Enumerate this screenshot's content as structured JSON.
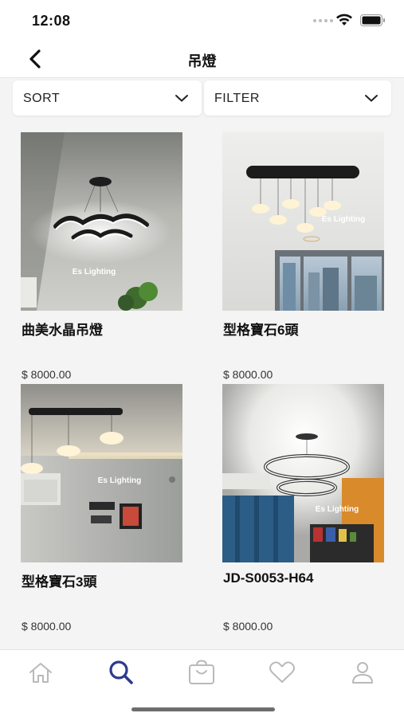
{
  "status_bar": {
    "time": "12:08"
  },
  "nav": {
    "title": "吊燈",
    "back_icon": "chevron-left-icon"
  },
  "toolbar": {
    "sort_label": "SORT",
    "filter_label": "FILTER"
  },
  "products": [
    {
      "name": "曲美水晶吊燈",
      "price": "$ 8000.00",
      "watermark": "Es Lighting"
    },
    {
      "name": "型格寶石6頭",
      "price": "$ 8000.00",
      "watermark": "Es Lighting"
    },
    {
      "name": "型格寶石3頭",
      "price": "$ 8000.00",
      "watermark": "Es Lighting"
    },
    {
      "name": "JD-S0053-H64",
      "price": "$ 8000.00",
      "watermark": "Es Lighting"
    }
  ],
  "tab_bar": {
    "active_tab": "search",
    "tabs": [
      {
        "id": "home",
        "icon": "home-icon"
      },
      {
        "id": "search",
        "icon": "search-icon"
      },
      {
        "id": "cart",
        "icon": "bag-icon"
      },
      {
        "id": "wishlist",
        "icon": "heart-icon"
      },
      {
        "id": "profile",
        "icon": "user-icon"
      }
    ]
  },
  "colors": {
    "accent": "#2d3a8c",
    "inactive_icon": "#b9b9b9",
    "background": "#f4f4f4"
  }
}
